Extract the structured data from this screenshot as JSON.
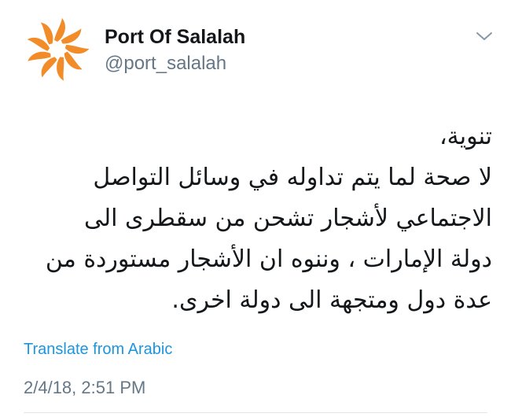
{
  "account": {
    "display_name": "Port Of Salalah",
    "handle": "@port_salalah",
    "avatar_icon": "sunburst-logo-icon",
    "avatar_color": "#f28c28"
  },
  "menu": {
    "icon": "chevron-down-icon"
  },
  "tweet": {
    "lines": [
      "تنوية،",
      "لا صحة لما يتم تداوله في وسائل التواصل",
      "الاجتماعي لأشجار تشحن من سقطرى الى",
      "دولة الإمارات ، وننوه ان الأشجار مستوردة من",
      "عدة دول ومتجهة الى دولة اخرى."
    ]
  },
  "translate_label": "Translate from Arabic",
  "timestamp": "2/4/18, 2:51 PM",
  "colors": {
    "link": "#1b95e0",
    "secondary_text": "#657786",
    "brand_orange": "#f28c28"
  }
}
